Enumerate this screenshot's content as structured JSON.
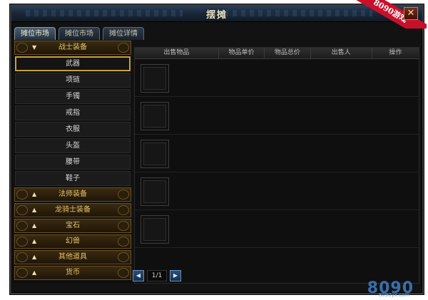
{
  "window": {
    "title": "摆摊",
    "close_label": "✕"
  },
  "brand": {
    "ribbon": "8090游戏",
    "watermark": "8090",
    "watermark_sub": "8090yx.com"
  },
  "tabs": [
    {
      "label": "摊位市场",
      "active": true
    },
    {
      "label": "摊位市场",
      "active": false
    },
    {
      "label": "摊位详情",
      "active": false
    }
  ],
  "categories": [
    {
      "label": "战士装备",
      "expanded": true,
      "items": [
        "武器",
        "项链",
        "手镯",
        "戒指",
        "衣服",
        "头盔",
        "腰带",
        "鞋子"
      ],
      "selected": "武器"
    },
    {
      "label": "法师装备",
      "expanded": false
    },
    {
      "label": "龙骑士装备",
      "expanded": false
    },
    {
      "label": "宝石",
      "expanded": false
    },
    {
      "label": "幻兽",
      "expanded": false
    },
    {
      "label": "其他道具",
      "expanded": false
    },
    {
      "label": "货币",
      "expanded": false
    }
  ],
  "table": {
    "columns": [
      "出售物品",
      "物品单价",
      "物品总价",
      "出售人",
      "操作"
    ],
    "row_count": 5
  },
  "pager": {
    "prev": "◀",
    "text": "1/1",
    "next": "▶"
  },
  "colors": {
    "accent_gold": "#c8a03a",
    "category_text": "#e6c36a",
    "brand_red": "#c8102a"
  }
}
